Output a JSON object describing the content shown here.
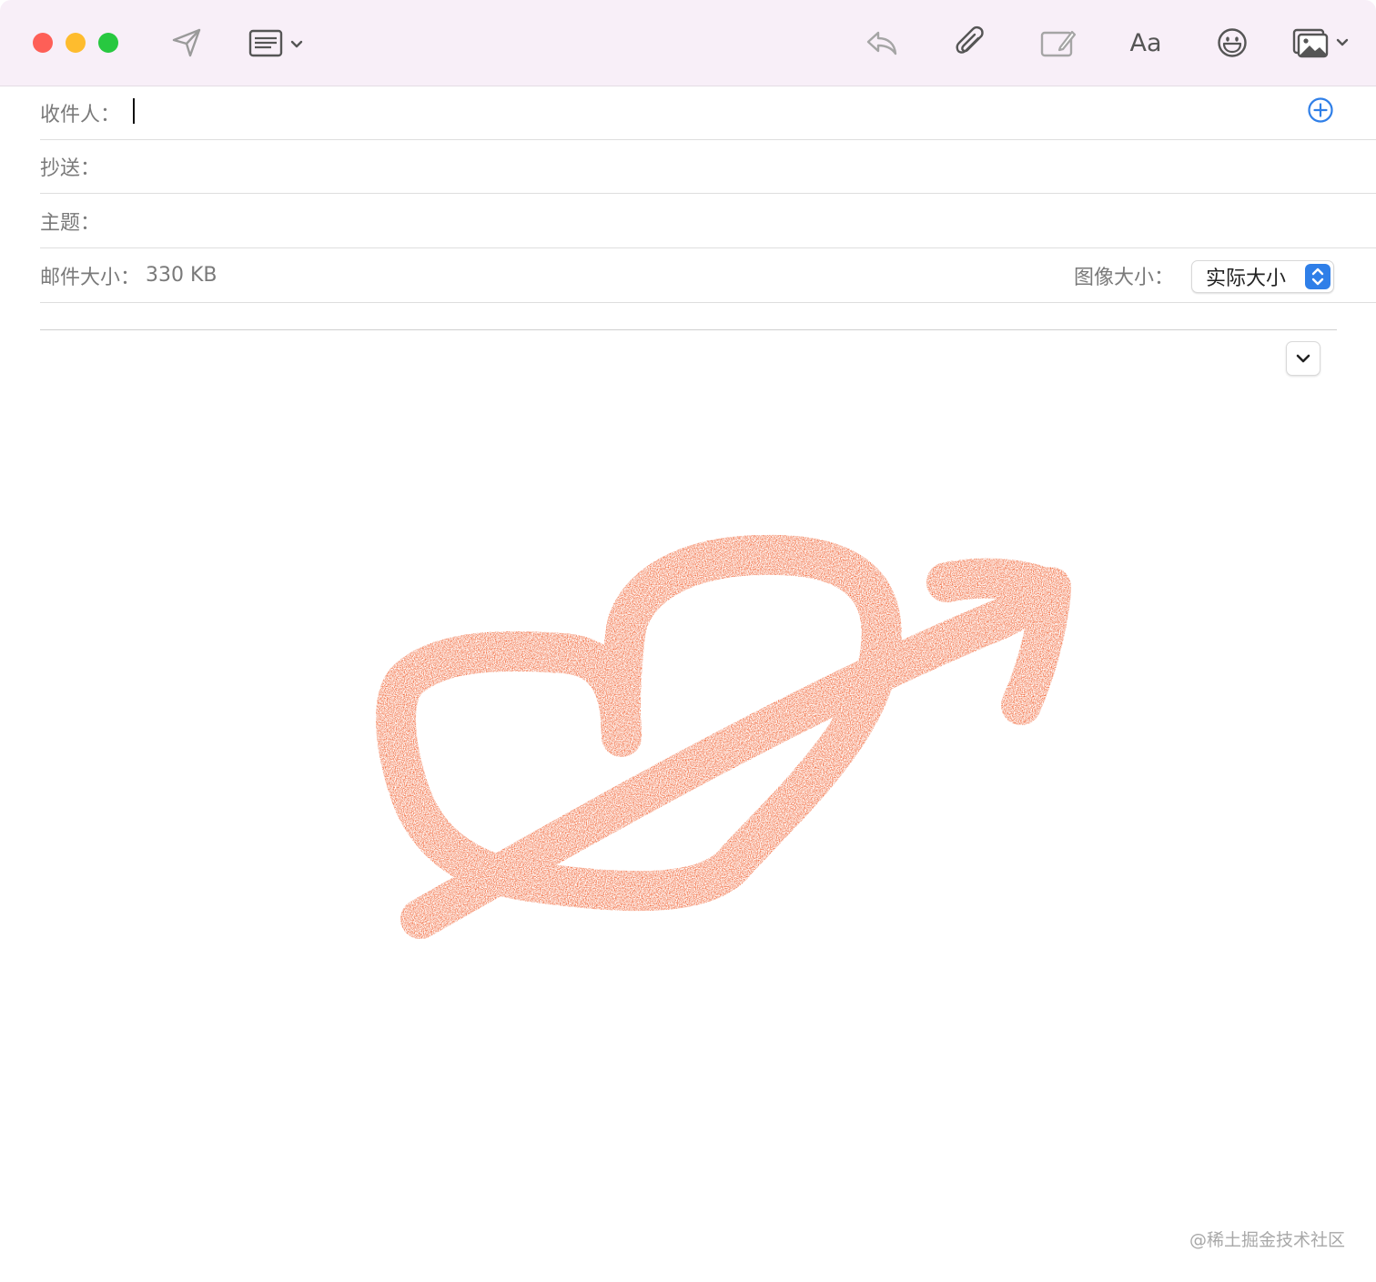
{
  "toolbar": {
    "traffic_lights": [
      {
        "name": "close",
        "color": "#fe5f57"
      },
      {
        "name": "minimize",
        "color": "#febc2e"
      },
      {
        "name": "zoom",
        "color": "#28c840"
      }
    ],
    "icons": [
      "send-icon",
      "header-fields-icon",
      "reply-icon",
      "attachment-icon",
      "markup-icon",
      "format-icon",
      "emoji-icon",
      "photo-browser-icon"
    ],
    "format_label": "Aa"
  },
  "header": {
    "to_label": "收件人：",
    "to_value": "",
    "cc_label": "抄送：",
    "cc_value": "",
    "subject_label": "主题：",
    "subject_value": "",
    "message_size_label": "邮件大小：",
    "message_size_value": "330 KB",
    "image_size_label": "图像大小：",
    "image_size_value": "实际大小"
  },
  "body": {
    "drawing": "orange hand-drawn heart pierced by an arrow",
    "drawing_color": "#f05a28"
  },
  "watermark": "@稀土掘金技术社区",
  "colors": {
    "accent": "#2f7fe8",
    "toolbar_bg": "#f8eff8"
  }
}
